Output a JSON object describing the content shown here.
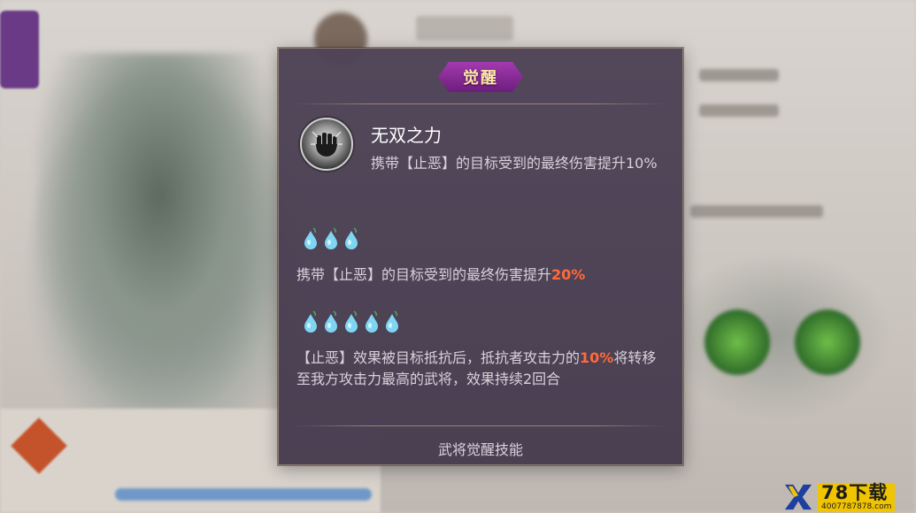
{
  "popup": {
    "title": "觉醒",
    "skill_name": "无双之力",
    "skill_desc": "携带【止恶】的目标受到的最终伤害提升10%",
    "tier1": {
      "drops": 3,
      "text_before": "携带【止恶】的目标受到的最终伤害提升",
      "highlight": "20%",
      "text_after": ""
    },
    "tier2": {
      "drops": 5,
      "text_before": "【止恶】效果被目标抵抗后，抵抗者攻击力的",
      "highlight": "10%",
      "text_after": "将转移至我方攻击力最高的武将，效果持续2回合"
    },
    "footer": "武将觉醒技能"
  },
  "colors": {
    "panel_bg": "#4a3e54",
    "title_badge": "#8b2a9b",
    "highlight": "#ff6a3a",
    "drop": "#7fd6f2"
  },
  "watermark": {
    "main": "78下载",
    "sub": "4007787878.com"
  },
  "icons": {
    "skill": "fist-power-icon",
    "drop": "water-drop-icon",
    "logo": "x-logo-icon"
  }
}
